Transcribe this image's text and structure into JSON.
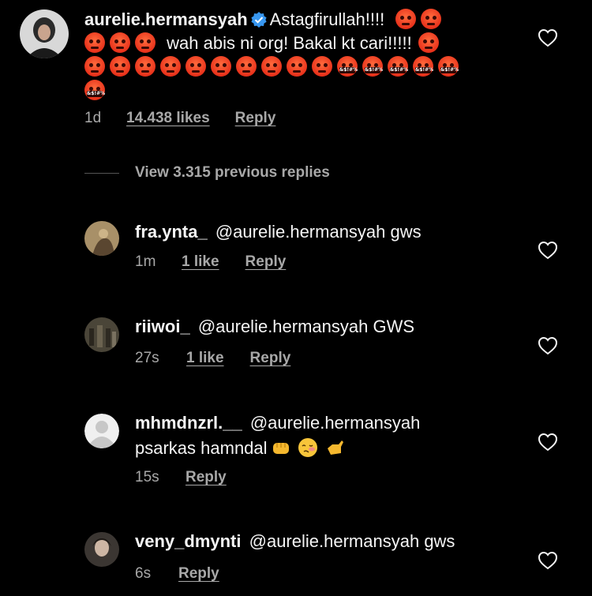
{
  "main_comment": {
    "username": "aurelie.hermansyah",
    "line1": "Astagfirullah!!!!",
    "line2": "wah abis ni org! Bakal kt cari!!!!!",
    "time": "1d",
    "likes": "14.438 likes",
    "reply": "Reply"
  },
  "view_replies": "View 3.315 previous replies",
  "replies": [
    {
      "username": "fra.ynta_",
      "mention": "@aurelie.hermansyah",
      "text": "gws",
      "time": "1m",
      "likes": "1 like",
      "reply": "Reply"
    },
    {
      "username": "riiwoi_",
      "mention": "@aurelie.hermansyah",
      "text": "GWS",
      "time": "27s",
      "likes": "1 like",
      "reply": "Reply"
    },
    {
      "username": "mhmdnzrl.__",
      "mention": "@aurelie.hermansyah",
      "text": "psarkas hamndal",
      "time": "15s",
      "reply": "Reply"
    },
    {
      "username": "veny_dmynti",
      "mention": "@aurelie.hermansyah",
      "text": "gws",
      "time": "6s",
      "reply": "Reply"
    }
  ],
  "colors": {
    "background": "#000000",
    "text": "#f5f5f5",
    "muted": "#a8a8a8",
    "verified": "#3897f0"
  },
  "icons": [
    "verified-badge-icon",
    "heart-icon",
    "angry-face-emoji",
    "cursing-face-emoji",
    "fist-emoji",
    "woozy-face-emoji",
    "call-me-hand-emoji"
  ]
}
